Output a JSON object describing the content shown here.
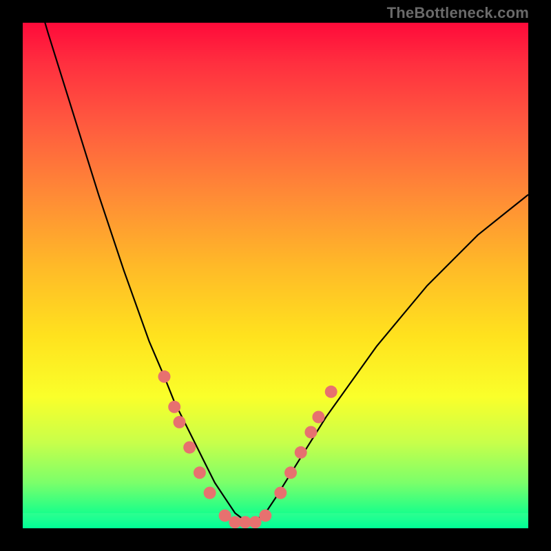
{
  "attribution": "TheBottleneck.com",
  "colors": {
    "background": "#000000",
    "marker_fill": "#e7716f",
    "marker_stroke": "#d64a4a",
    "curve_stroke": "#000000"
  },
  "chart_data": {
    "type": "line",
    "title": "",
    "xlabel": "",
    "ylabel": "",
    "xlim": [
      0,
      100
    ],
    "ylim": [
      0,
      100
    ],
    "x": [
      0,
      5,
      10,
      15,
      20,
      25,
      28,
      30,
      32,
      34,
      36,
      38,
      40,
      42,
      44,
      46,
      48,
      50,
      55,
      60,
      65,
      70,
      75,
      80,
      85,
      90,
      95,
      100
    ],
    "values": [
      115,
      98,
      82,
      66,
      51,
      37,
      30,
      25,
      21,
      17,
      13,
      9,
      6,
      3,
      1.5,
      1.5,
      3,
      6,
      14,
      22,
      29,
      36,
      42,
      48,
      53,
      58,
      62,
      66
    ],
    "markers": [
      {
        "x": 28,
        "y": 30
      },
      {
        "x": 30,
        "y": 24
      },
      {
        "x": 31,
        "y": 21
      },
      {
        "x": 33,
        "y": 16
      },
      {
        "x": 35,
        "y": 11
      },
      {
        "x": 37,
        "y": 7
      },
      {
        "x": 40,
        "y": 2.5
      },
      {
        "x": 42,
        "y": 1.2
      },
      {
        "x": 44,
        "y": 1.2
      },
      {
        "x": 46,
        "y": 1.2
      },
      {
        "x": 48,
        "y": 2.5
      },
      {
        "x": 51,
        "y": 7
      },
      {
        "x": 53,
        "y": 11
      },
      {
        "x": 55,
        "y": 15
      },
      {
        "x": 57,
        "y": 19
      },
      {
        "x": 58.5,
        "y": 22
      },
      {
        "x": 61,
        "y": 27
      }
    ]
  }
}
